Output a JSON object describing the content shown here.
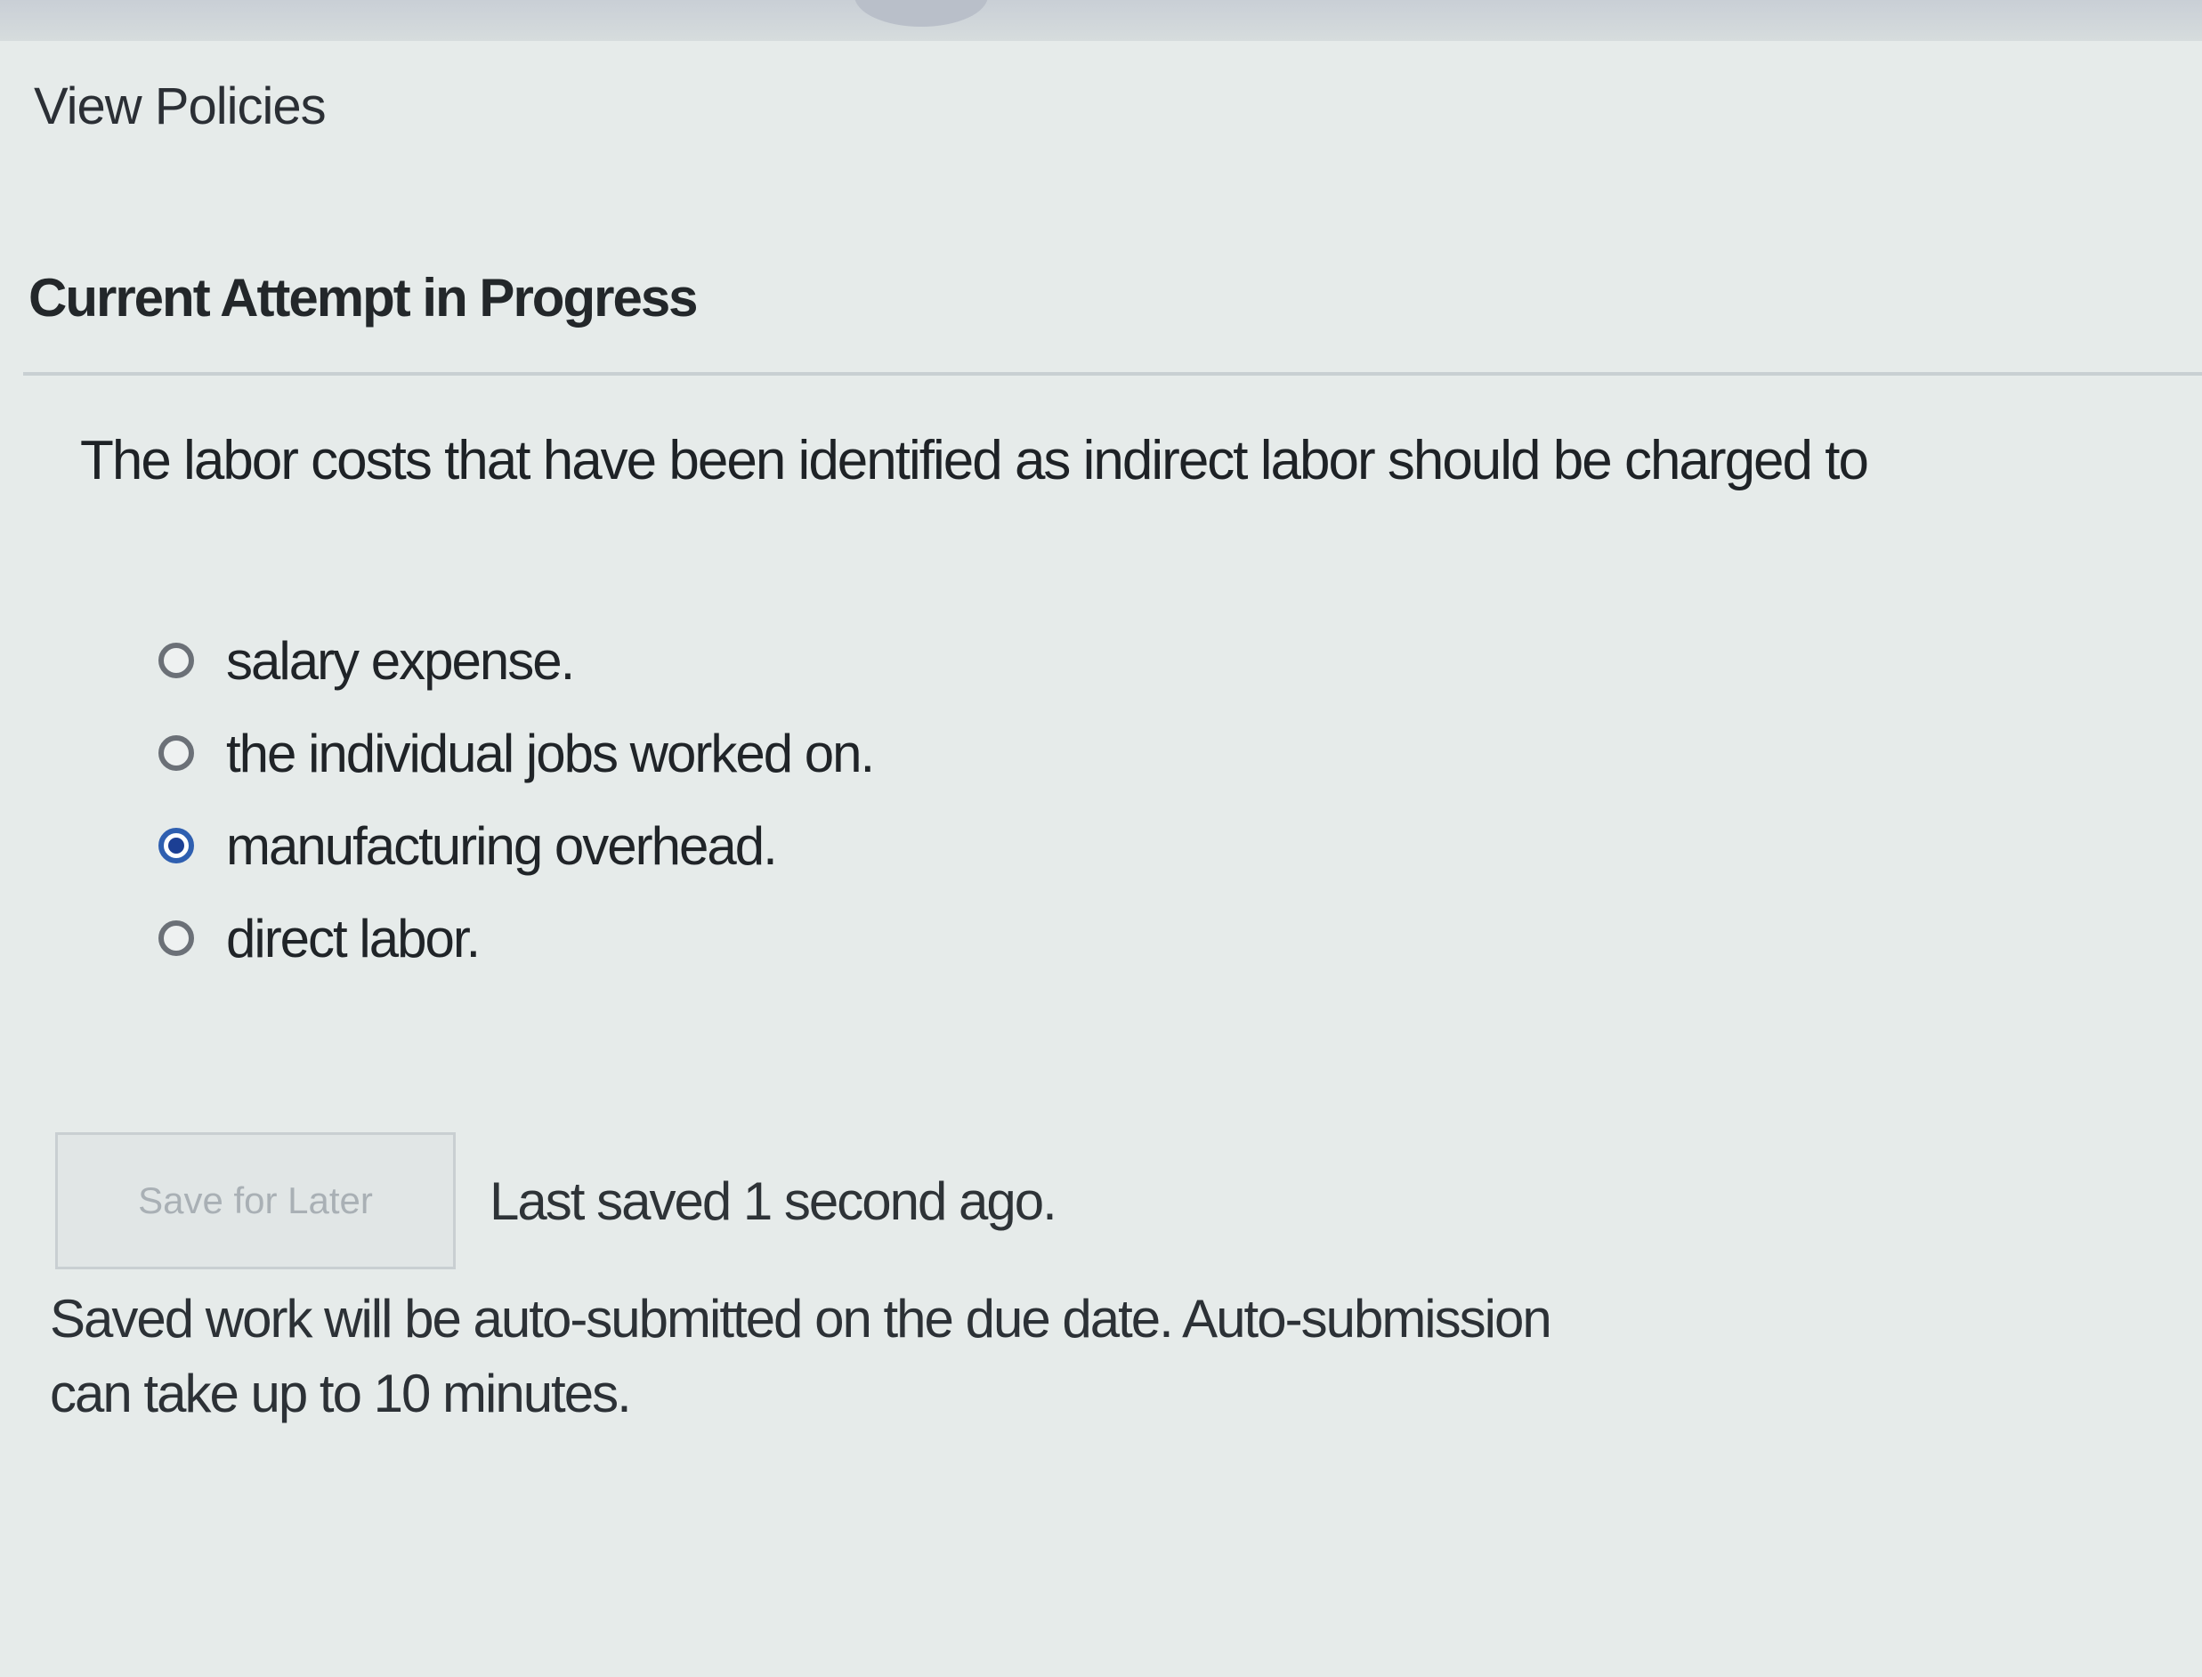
{
  "header": {
    "view_policies_label": "View Policies"
  },
  "attempt": {
    "title": "Current Attempt in Progress"
  },
  "question": {
    "prompt": "The labor costs that have been identified as indirect labor should be charged to",
    "options": [
      {
        "label": "salary expense.",
        "selected": false
      },
      {
        "label": "the individual jobs worked on.",
        "selected": false
      },
      {
        "label": "manufacturing overhead.",
        "selected": true
      },
      {
        "label": "direct labor.",
        "selected": false
      }
    ]
  },
  "footer": {
    "save_button_label": "Save for Later",
    "last_saved_text": "Last saved 1 second ago.",
    "autosubmit_note": "Saved work will be auto-submitted on the due date. Auto-submission can take up to 10 minutes."
  },
  "colors": {
    "selected_radio": "#1c3f94",
    "background": "#e6ebea"
  },
  "icons": [
    "radio-unchecked-icon",
    "radio-checked-icon"
  ]
}
